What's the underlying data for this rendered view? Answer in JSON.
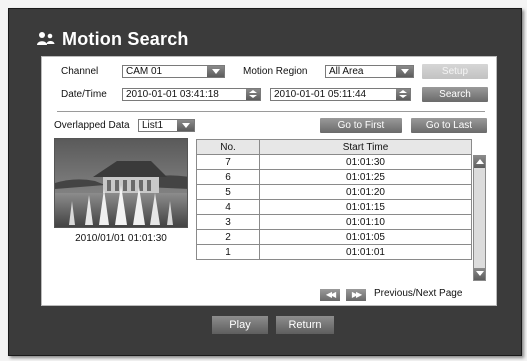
{
  "window": {
    "title": "Motion Search",
    "title_icon": "person-icon"
  },
  "filters": {
    "channel_label": "Channel",
    "channel_value": "CAM 01",
    "motion_region_label": "Motion Region",
    "motion_region_value": "All Area",
    "setup_label": "Setup",
    "datetime_label": "Date/Time",
    "start_datetime": "2010-01-01  03:41:18",
    "end_datetime": "2010-01-01  05:11:44",
    "search_label": "Search"
  },
  "overlapped": {
    "label": "Overlapped Data",
    "value": "List1"
  },
  "nav": {
    "first_label": "Go to First",
    "last_label": "Go to Last"
  },
  "preview": {
    "caption": "2010/01/01  01:01:30"
  },
  "table": {
    "headers": [
      "No.",
      "Start Time"
    ],
    "rows": [
      {
        "no": "7",
        "time": "01:01:30"
      },
      {
        "no": "6",
        "time": "01:01:25"
      },
      {
        "no": "5",
        "time": "01:01:20"
      },
      {
        "no": "4",
        "time": "01:01:15"
      },
      {
        "no": "3",
        "time": "01:01:10"
      },
      {
        "no": "2",
        "time": "01:01:05"
      },
      {
        "no": "1",
        "time": "01:01:01"
      }
    ]
  },
  "paging": {
    "prev_glyph": "◀◀",
    "next_glyph": "▶▶",
    "label": "Previous/Next Page"
  },
  "actions": {
    "play_label": "Play",
    "return_label": "Return"
  },
  "colors": {
    "frame": "#3b3b3b",
    "button": "#7a7a7a",
    "panel": "#ffffff"
  }
}
